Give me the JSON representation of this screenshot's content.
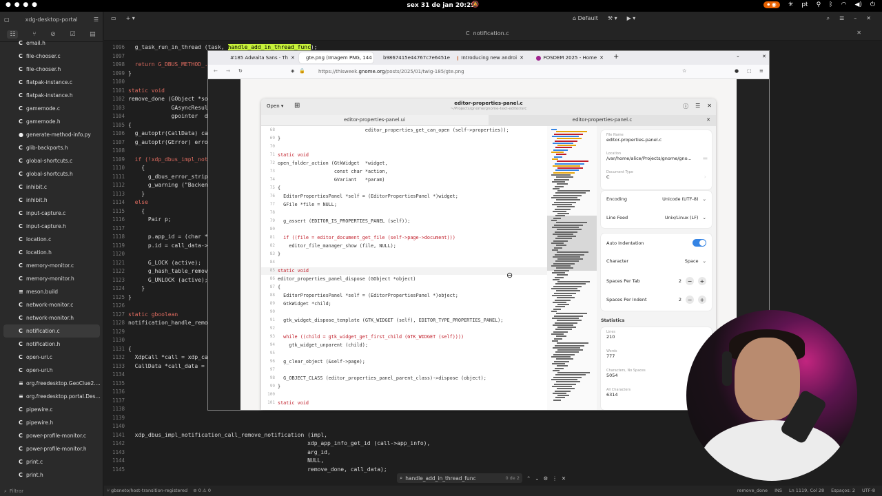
{
  "topbar": {
    "clock": "sex 31 de jan 20:29",
    "lang": "pt",
    "rec_label": "● ⏺"
  },
  "sidebar": {
    "title": "xdg-desktop-portal",
    "filter_placeholder": "Filtrar",
    "files": [
      {
        "name": "email.h",
        "icon": "C"
      },
      {
        "name": "file-chooser.c",
        "icon": "C"
      },
      {
        "name": "file-chooser.h",
        "icon": "C"
      },
      {
        "name": "flatpak-instance.c",
        "icon": "C"
      },
      {
        "name": "flatpak-instance.h",
        "icon": "C"
      },
      {
        "name": "gamemode.c",
        "icon": "C"
      },
      {
        "name": "gamemode.h",
        "icon": "C"
      },
      {
        "name": "generate-method-info.py",
        "icon": "●"
      },
      {
        "name": "glib-backports.h",
        "icon": "C"
      },
      {
        "name": "global-shortcuts.c",
        "icon": "C"
      },
      {
        "name": "global-shortcuts.h",
        "icon": "C"
      },
      {
        "name": "inhibit.c",
        "icon": "C"
      },
      {
        "name": "inhibit.h",
        "icon": "C"
      },
      {
        "name": "input-capture.c",
        "icon": "C"
      },
      {
        "name": "input-capture.h",
        "icon": "C"
      },
      {
        "name": "location.c",
        "icon": "C"
      },
      {
        "name": "location.h",
        "icon": "C"
      },
      {
        "name": "memory-monitor.c",
        "icon": "C"
      },
      {
        "name": "memory-monitor.h",
        "icon": "C"
      },
      {
        "name": "meson.build",
        "icon": "≡"
      },
      {
        "name": "network-monitor.c",
        "icon": "C"
      },
      {
        "name": "network-monitor.h",
        "icon": "C"
      },
      {
        "name": "notification.c",
        "icon": "C",
        "selected": true
      },
      {
        "name": "notification.h",
        "icon": "C"
      },
      {
        "name": "open-uri.c",
        "icon": "C"
      },
      {
        "name": "open-uri.h",
        "icon": "C"
      },
      {
        "name": "org.freedesktop.GeoClue2....",
        "icon": "≡"
      },
      {
        "name": "org.freedesktop.portal.Des...",
        "icon": "≡"
      },
      {
        "name": "pipewire.c",
        "icon": "C"
      },
      {
        "name": "pipewire.h",
        "icon": "C"
      },
      {
        "name": "power-profile-monitor.c",
        "icon": "C"
      },
      {
        "name": "power-profile-monitor.h",
        "icon": "C"
      },
      {
        "name": "print.c",
        "icon": "C"
      },
      {
        "name": "print.h",
        "icon": "C"
      }
    ]
  },
  "editor": {
    "build_profile": "Default",
    "tab_title": "notification.c",
    "lines": [
      {
        "n": "1096",
        "t": "  g_task_run_in_thread (task, handle_add_in_thread_func);",
        "hl": true
      },
      {
        "n": "1097",
        "t": ""
      },
      {
        "n": "1098",
        "t": "  return G_DBUS_METHOD_..."
      },
      {
        "n": "1099",
        "t": "}"
      },
      {
        "n": "1100",
        "t": ""
      },
      {
        "n": "1101",
        "t": "static void"
      },
      {
        "n": "1102",
        "t": "remove_done (GObject *so"
      },
      {
        "n": "1103",
        "t": "             GAsyncResul"
      },
      {
        "n": "1104",
        "t": "             gpointer  da"
      },
      {
        "n": "1105",
        "t": "{"
      },
      {
        "n": "1106",
        "t": "  g_autoptr(CallData) ca"
      },
      {
        "n": "1107",
        "t": "  g_autoptr(GError) erro"
      },
      {
        "n": "1108",
        "t": ""
      },
      {
        "n": "1109",
        "t": "  if (!xdp_dbus_impl_noti"
      },
      {
        "n": "1110",
        "t": "    {"
      },
      {
        "n": "1111",
        "t": "      g_dbus_error_strip"
      },
      {
        "n": "1112",
        "t": "      g_warning (\"Backen"
      },
      {
        "n": "1113",
        "t": "    }"
      },
      {
        "n": "1114",
        "t": "  else"
      },
      {
        "n": "1115",
        "t": "    {"
      },
      {
        "n": "1116",
        "t": "      Pair p;"
      },
      {
        "n": "1117",
        "t": ""
      },
      {
        "n": "1118",
        "t": "      p.app_id = (char *"
      },
      {
        "n": "1119",
        "t": "      p.id = call_data->"
      },
      {
        "n": "1120",
        "t": ""
      },
      {
        "n": "1121",
        "t": "      G_LOCK (active);"
      },
      {
        "n": "1122",
        "t": "      g_hash_table_remov"
      },
      {
        "n": "1123",
        "t": "      G_UNLOCK (active);"
      },
      {
        "n": "1124",
        "t": "    }"
      },
      {
        "n": "1125",
        "t": "}"
      },
      {
        "n": "1126",
        "t": ""
      },
      {
        "n": "1127",
        "t": "static gboolean"
      },
      {
        "n": "1128",
        "t": "notification_handle_remo"
      },
      {
        "n": "1129",
        "t": ""
      },
      {
        "n": "1130",
        "t": ""
      },
      {
        "n": "1131",
        "t": "{"
      },
      {
        "n": "1132",
        "t": "  XdpCall *call = xdp_ca"
      },
      {
        "n": "1133",
        "t": "  CallData *call_data ="
      },
      {
        "n": "1134",
        "t": ""
      },
      {
        "n": "1135",
        "t": ""
      },
      {
        "n": "1136",
        "t": ""
      },
      {
        "n": "1137",
        "t": ""
      },
      {
        "n": "1138",
        "t": ""
      },
      {
        "n": "1139",
        "t": ""
      },
      {
        "n": "1140",
        "t": ""
      },
      {
        "n": "1141",
        "t": "  xdp_dbus_impl_notification_call_remove_notification (impl,"
      },
      {
        "n": "1142",
        "t": "                                                      xdp_app_info_get_id (call->app_info),"
      },
      {
        "n": "1143",
        "t": "                                                      arg_id,"
      },
      {
        "n": "1144",
        "t": "                                                      NULL,"
      },
      {
        "n": "1145",
        "t": "                                                      remove_done, call_data);"
      }
    ],
    "search": {
      "query": "handle_add_in_thread_func",
      "count": "0 de 2"
    },
    "status": {
      "branch": "gbsneto/host-transition-registered",
      "warnings": "0",
      "errors": "0",
      "fn": "remove_done",
      "mode": "INS",
      "position": "Ln 1119, Col 28",
      "spaces": "Espaços: 2",
      "encoding": "UTF-8"
    }
  },
  "browser": {
    "tabs": [
      {
        "label": "#185 Adwaita Sans · Th",
        "color": "#3584e4"
      },
      {
        "label": "gte.png (Imagem PNG, 144",
        "color": "#888",
        "active": true
      },
      {
        "label": "b9867415e44767c7e6451e",
        "color": "#888"
      },
      {
        "label": "Introducing new androi",
        "color": "#c64600"
      },
      {
        "label": "FOSDEM 2025 - Home",
        "color": "#a0238f"
      }
    ],
    "url_prefix": "https://thisweek.",
    "url_domain": "gnome.org",
    "url_path": "/posts/2025/01/twig-185/gte.png"
  },
  "gte": {
    "open_label": "Open",
    "title": "editor-properties-panel.c",
    "subtitle": "~/Projects/gnome/gnome-text-editor/src",
    "tab1": "editor-properties-panel.ui",
    "tab2": "editor-properties-panel.c",
    "code": [
      {
        "n": "68",
        "t": "                               editor_properties_get_can_open (self->properties));"
      },
      {
        "n": "69",
        "t": "}"
      },
      {
        "n": "70",
        "t": ""
      },
      {
        "n": "71",
        "t": "static void",
        "k": true
      },
      {
        "n": "72",
        "t": "open_folder_action (GtkWidget  *widget,"
      },
      {
        "n": "73",
        "t": "                    const char *action,"
      },
      {
        "n": "74",
        "t": "                    GVariant   *param)"
      },
      {
        "n": "75",
        "t": "{"
      },
      {
        "n": "76",
        "t": "  EditorPropertiesPanel *self = (EditorPropertiesPanel *)widget;"
      },
      {
        "n": "77",
        "t": "  GFile *file = NULL;"
      },
      {
        "n": "78",
        "t": ""
      },
      {
        "n": "79",
        "t": "  g_assert (EDITOR_IS_PROPERTIES_PANEL (self));"
      },
      {
        "n": "80",
        "t": ""
      },
      {
        "n": "81",
        "t": "  if ((file = editor_document_get_file (self->page->document)))"
      },
      {
        "n": "82",
        "t": "    editor_file_manager_show (file, NULL);"
      },
      {
        "n": "83",
        "t": "}"
      },
      {
        "n": "84",
        "t": ""
      },
      {
        "n": "85",
        "t": "static void",
        "k": true
      },
      {
        "n": "86",
        "t": "editor_properties_panel_dispose (GObject *object)"
      },
      {
        "n": "87",
        "t": "{"
      },
      {
        "n": "88",
        "t": "  EditorPropertiesPanel *self = (EditorPropertiesPanel *)object;"
      },
      {
        "n": "89",
        "t": "  GtkWidget *child;"
      },
      {
        "n": "90",
        "t": ""
      },
      {
        "n": "91",
        "t": "  gtk_widget_dispose_template (GTK_WIDGET (self), EDITOR_TYPE_PROPERTIES_PANEL);"
      },
      {
        "n": "92",
        "t": ""
      },
      {
        "n": "93",
        "t": "  while ((child = gtk_widget_get_first_child (GTK_WIDGET (self))))"
      },
      {
        "n": "94",
        "t": "    gtk_widget_unparent (child);"
      },
      {
        "n": "95",
        "t": ""
      },
      {
        "n": "96",
        "t": "  g_clear_object (&self->page);"
      },
      {
        "n": "97",
        "t": ""
      },
      {
        "n": "98",
        "t": "  G_OBJECT_CLASS (editor_properties_panel_parent_class)->dispose (object);"
      },
      {
        "n": "99",
        "t": "}"
      },
      {
        "n": "100",
        "t": ""
      },
      {
        "n": "101",
        "t": "static void",
        "k": true
      }
    ],
    "panel": {
      "file_name_label": "File Name",
      "file_name": "editor-properties-panel.c",
      "location_label": "Location",
      "location": "/var/home/alice/Projects/gnome/gno...",
      "doc_type_label": "Document Type",
      "doc_type": "C",
      "encoding_label": "Encoding",
      "encoding": "Unicode (UTF-8)",
      "line_feed_label": "Line Feed",
      "line_feed": "Unix/Linux (LF)",
      "auto_indent_label": "Auto Indentation",
      "character_label": "Character",
      "character": "Space",
      "spaces_tab_label": "Spaces Per Tab",
      "spaces_tab": "2",
      "spaces_indent_label": "Spaces Per Indent",
      "spaces_indent": "2",
      "stats_title": "Statistics",
      "lines_label": "Lines",
      "lines": "210",
      "words_label": "Words",
      "words": "777",
      "chars_ns_label": "Characters, No Spaces",
      "chars_ns": "5054",
      "chars_label": "All Characters",
      "chars": "6314"
    }
  }
}
